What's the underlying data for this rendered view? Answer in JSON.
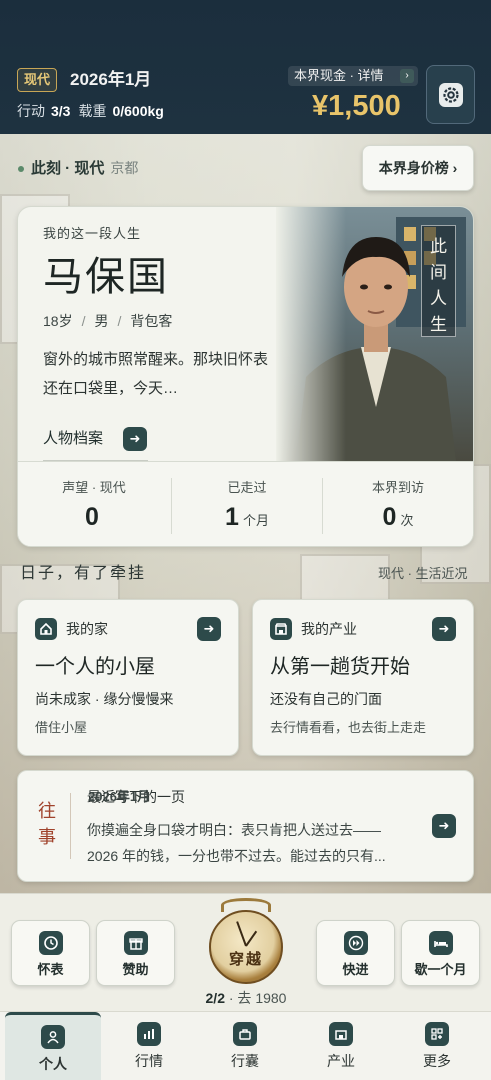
{
  "header": {
    "era_badge": "现代",
    "date": "2026年1月",
    "actions_label": "行动",
    "actions_value": "3/3",
    "load_label": "载重",
    "load_value": "0/600kg",
    "cash_label": "本界现金 · 详情",
    "cash_amount": "¥1,500",
    "settings_icon": "gear-icon"
  },
  "location": {
    "now_label": "此刻 · 现代",
    "city": "京都",
    "rank_button": "本界身价榜 ›"
  },
  "profile": {
    "subtitle": "我的这一段人生",
    "name": "马保国",
    "age": "18岁",
    "gender": "男",
    "role": "背包客",
    "story": "窗外的城市照常醒来。那块旧怀表还在口袋里，今天…",
    "archive_label": "人物档案",
    "vertical_label": "此间人生",
    "stats": [
      {
        "label": "声望 · 现代",
        "value": "0",
        "unit": ""
      },
      {
        "label": "已走过",
        "value": "1",
        "unit": "个月"
      },
      {
        "label": "本界到访",
        "value": "0",
        "unit": "次"
      }
    ]
  },
  "section": {
    "title": "日子，有了牵挂",
    "note": "现代 · 生活近况"
  },
  "cards": [
    {
      "kicker": "我的家",
      "icon": "home-icon",
      "head": "一个人的小屋",
      "line1": "尚未成家 · 缘分慢慢来",
      "line2": "借住小屋"
    },
    {
      "kicker": "我的产业",
      "icon": "shop-icon",
      "head": "从第一趟货开始",
      "line1": "还没有自己的门面",
      "line2": "去行情看看，也去街上走走"
    }
  ],
  "journal": {
    "tag": "往事",
    "title": "最近写下的一页",
    "date": "2026年1月",
    "body": "你摸遍全身口袋才明白：表只肯把人送过去——2026 年的钱，一分也带不过去。能过去的只有..."
  },
  "actions": [
    {
      "label": "怀表",
      "icon": "clock-icon"
    },
    {
      "label": "赞助",
      "icon": "gift-icon"
    },
    {
      "label": "快进",
      "icon": "fast-forward-icon"
    },
    {
      "label": "歇一个月",
      "icon": "bed-icon"
    }
  ],
  "travel": {
    "button_label": "穿越",
    "count": "2/2",
    "dest": " · 去 1980"
  },
  "nav": [
    {
      "label": "个人",
      "icon": "person-icon",
      "active": true
    },
    {
      "label": "行情",
      "icon": "chart-icon",
      "active": false
    },
    {
      "label": "行囊",
      "icon": "bag-icon",
      "active": false
    },
    {
      "label": "产业",
      "icon": "shop-icon",
      "active": false
    },
    {
      "label": "更多",
      "icon": "grid-plus-icon",
      "active": false
    }
  ],
  "colors": {
    "header_bg": "#1b2e3d",
    "gold": "#e8c46a",
    "accent": "#2d4a4a",
    "journal_tag": "#a0432c"
  }
}
